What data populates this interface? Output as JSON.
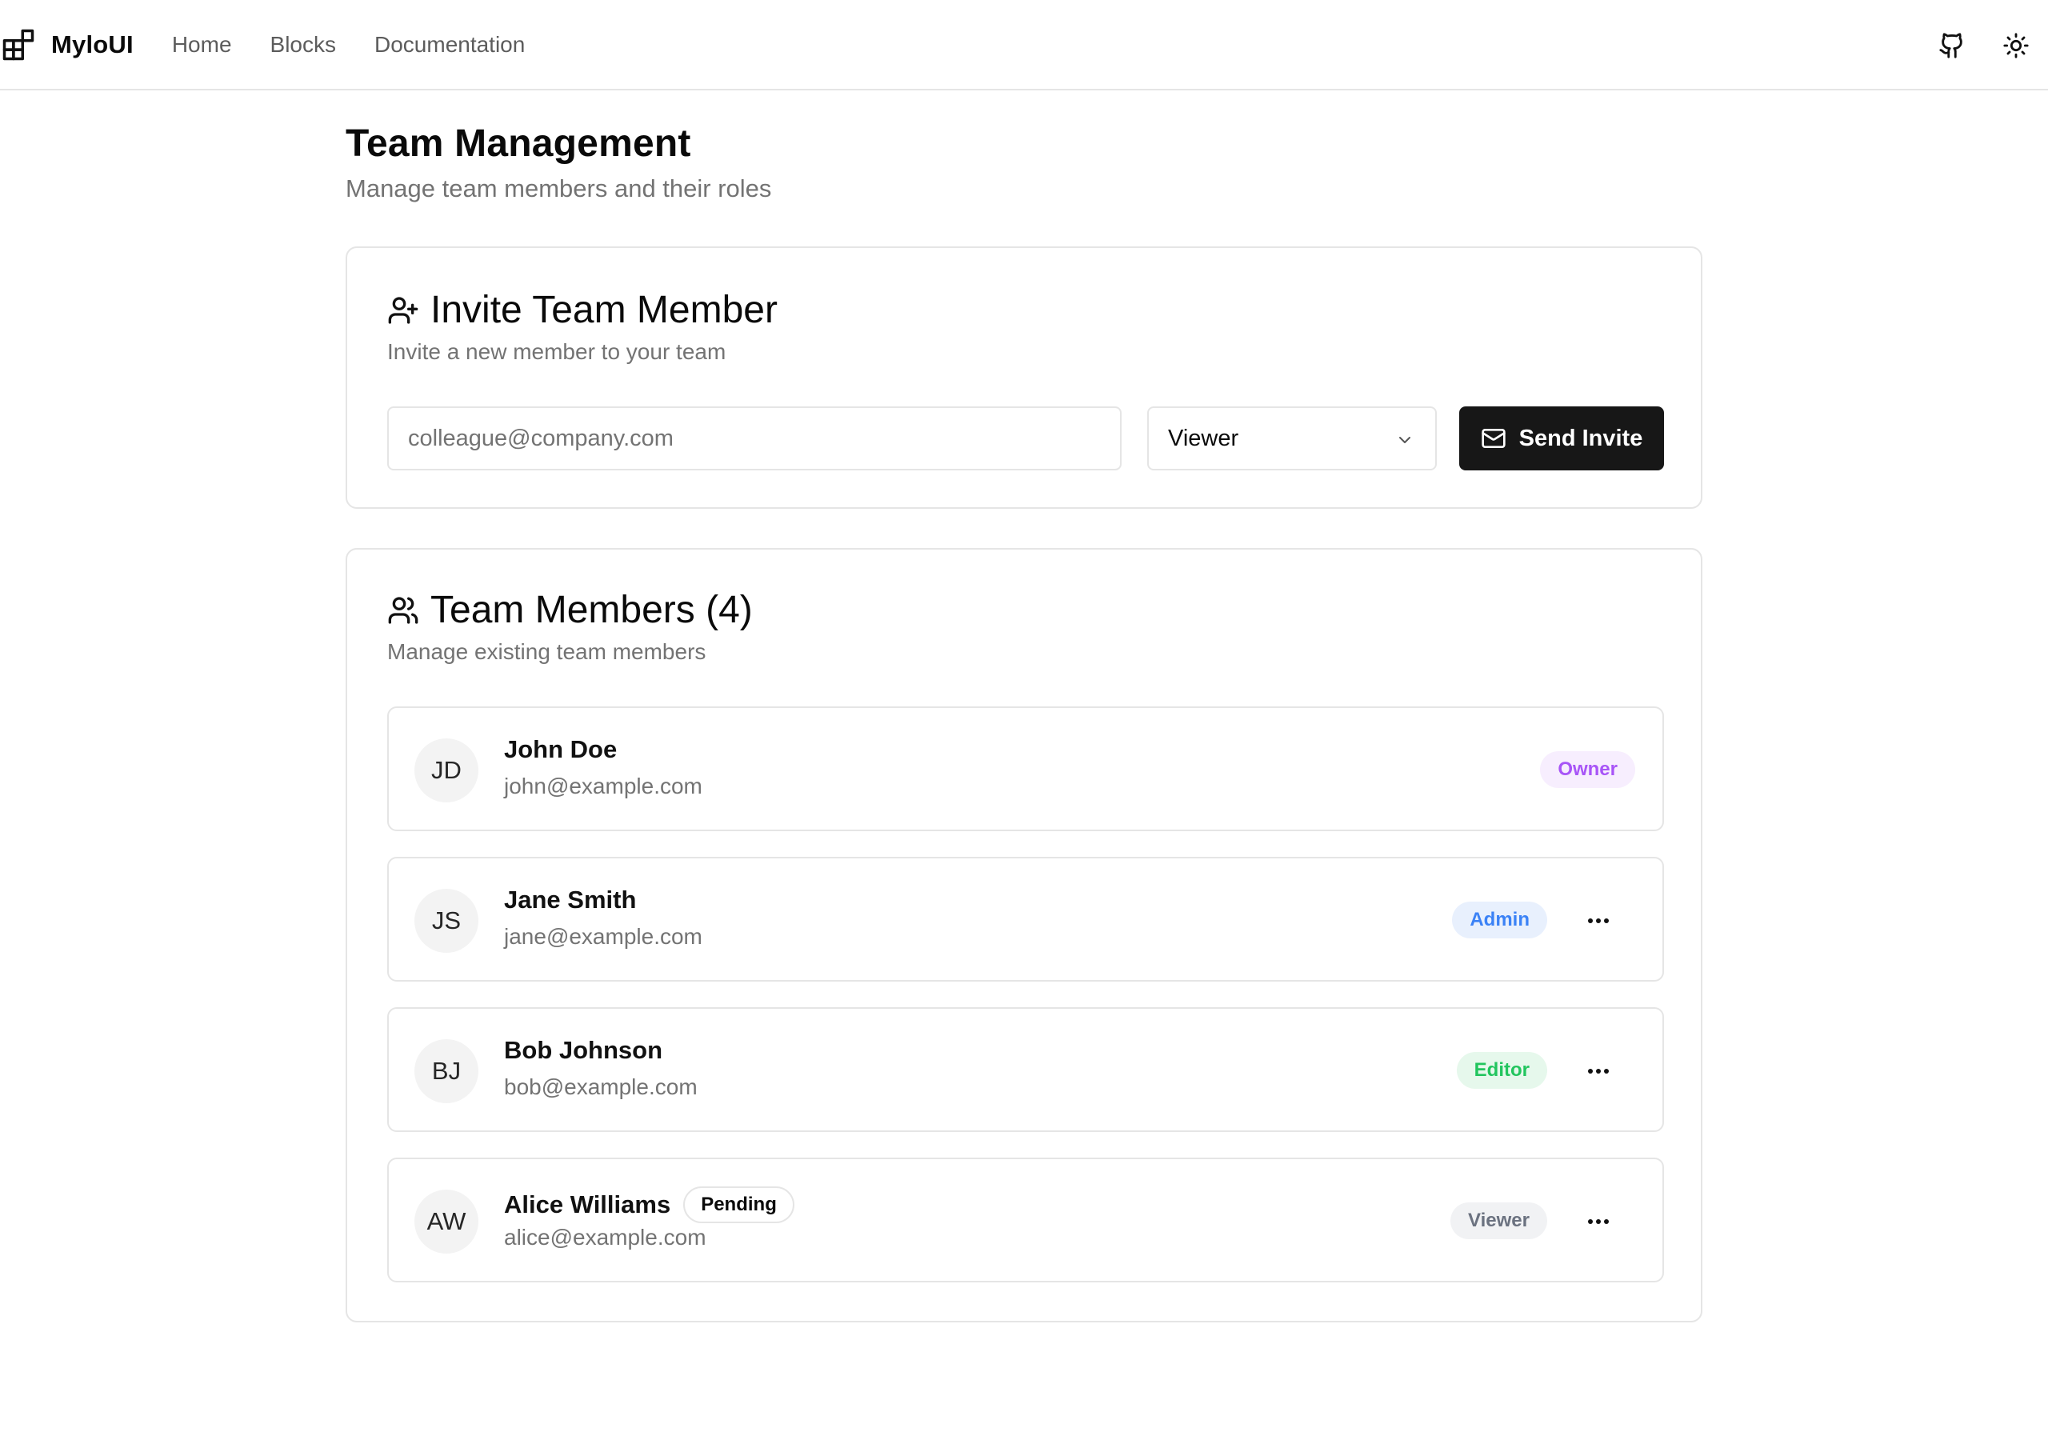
{
  "brand": {
    "name": "MyloUI",
    "icon": "blocks-icon"
  },
  "nav": [
    {
      "label": "Home"
    },
    {
      "label": "Blocks"
    },
    {
      "label": "Documentation"
    }
  ],
  "top_actions": {
    "github_icon": "github-icon",
    "theme_icon": "sun-icon"
  },
  "page": {
    "title": "Team Management",
    "subtitle": "Manage team members and their roles"
  },
  "invite": {
    "icon": "user-plus-icon",
    "title": "Invite Team Member",
    "description": "Invite a new member to your team",
    "email_placeholder": "colleague@company.com",
    "email_value": "",
    "role_value": "Viewer",
    "send_label": "Send Invite",
    "send_icon": "mail-icon"
  },
  "members": {
    "icon": "users-icon",
    "title": "Team Members (4)",
    "description": "Manage existing team members",
    "list": [
      {
        "initials": "JD",
        "name": "John Doe",
        "email": "john@example.com",
        "role": "Owner",
        "pending": "",
        "has_menu": false
      },
      {
        "initials": "JS",
        "name": "Jane Smith",
        "email": "jane@example.com",
        "role": "Admin",
        "pending": "",
        "has_menu": true
      },
      {
        "initials": "BJ",
        "name": "Bob Johnson",
        "email": "bob@example.com",
        "role": "Editor",
        "pending": "",
        "has_menu": true
      },
      {
        "initials": "AW",
        "name": "Alice Williams",
        "email": "alice@example.com",
        "role": "Viewer",
        "pending": "Pending",
        "has_menu": true
      }
    ]
  },
  "colors": {
    "owner_text": "#a855f7",
    "owner_bg": "#f7eefe",
    "admin_text": "#3b82f6",
    "admin_bg": "#e8f0fd",
    "editor_text": "#22c55e",
    "editor_bg": "#e6f8ec",
    "viewer_text": "#6b7280",
    "viewer_bg": "#f1f2f4",
    "primary_button": "#171717"
  }
}
